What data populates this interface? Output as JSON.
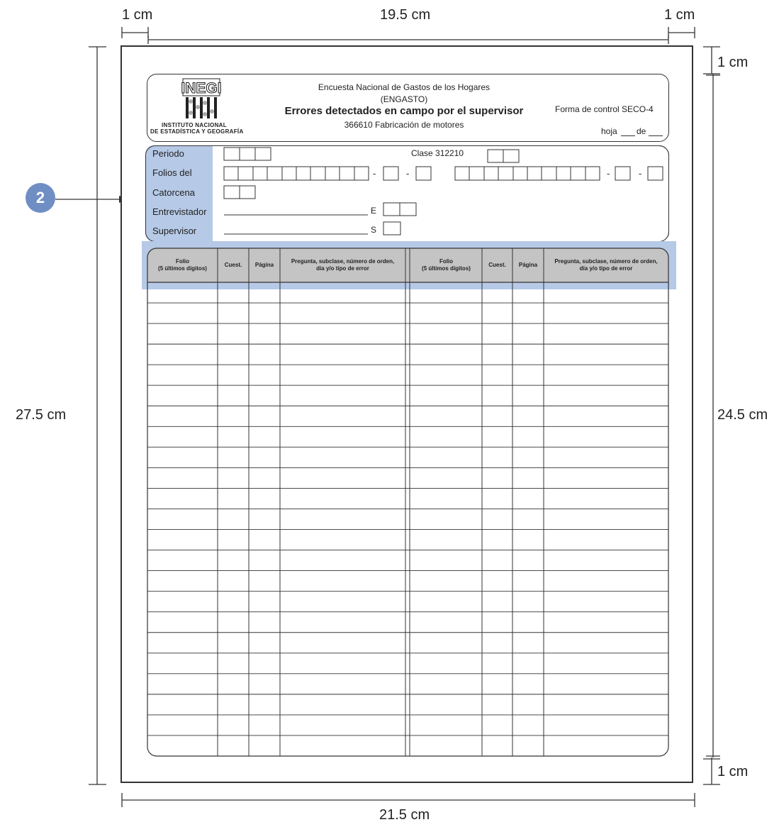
{
  "dimensions": {
    "left_margin": "1 cm",
    "content_width": "19.5 cm",
    "right_margin": "1 cm",
    "top_margin": "1 cm",
    "page_height": "27.5 cm",
    "content_height": "24.5 cm",
    "bottom_margin": "1 cm",
    "page_width": "21.5 cm"
  },
  "callout": {
    "number": "2"
  },
  "header": {
    "logo_text": "INEGI",
    "institute_line1": "INSTITUTO NACIONAL",
    "institute_line2": "DE ESTADÍSTICA Y GEOGRAFÍA",
    "survey": "Encuesta Nacional de Gastos de los Hogares",
    "acronym": "(ENGASTO)",
    "title": "Errores detectados en campo por el supervisor",
    "subtitle": "366610 Fabricación de motores",
    "form_control": "Forma de control SECO-4",
    "hoja": "hoja",
    "de": "de"
  },
  "fields": {
    "periodo": "Periodo",
    "folios_del": "Folios del",
    "catorcena": "Catorcena",
    "entrevistador": "Entrevistador",
    "supervisor": "Supervisor",
    "clase": "Clase 312210",
    "e_label": "E",
    "s_label": "S",
    "dash": "-"
  },
  "table": {
    "headers": [
      "Folio (5 últimos dígitos)",
      "Cuest.",
      "Página",
      "Pregunta, subclase, número de orden, día y/o tipo de error"
    ],
    "header_line1": [
      "Folio",
      "Cuest.",
      "Página",
      "Pregunta, subclase, número de orden,"
    ],
    "header_line2": [
      "(5 últimos dígitos)",
      "",
      "",
      "día y/o tipo de error"
    ],
    "row_count": 23
  },
  "colors": {
    "highlight": "#b6c9e6",
    "header_fill": "#c4c4c4",
    "badge": "#6f8fc4",
    "line": "#333333"
  }
}
